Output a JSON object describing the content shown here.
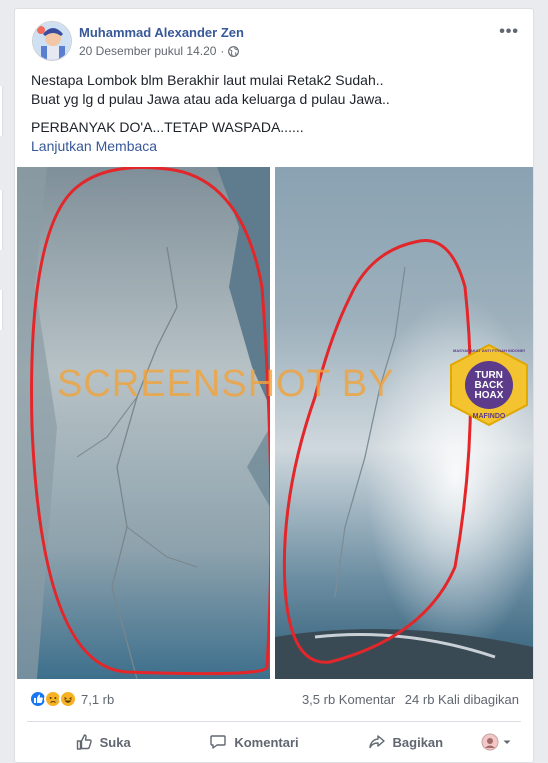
{
  "post": {
    "author": "Muhammad Alexander Zen",
    "timestamp": "20 Desember pukul 14.20",
    "privacy_icon": "globe-icon",
    "more_label": "•••",
    "lines": [
      "Nestapa Lombok blm Berakhir laut mulai Retak2 Sudah..",
      "Buat yg lg d pulau Jawa atau ada keluarga d pulau Jawa.."
    ],
    "line3": "PERBANYAK DO'A...TETAP WASPADA......",
    "see_more": "Lanjutkan Membaca"
  },
  "image": {
    "watermark": "SCREENSHOT BY",
    "logo_line1": "TURN",
    "logo_line2": "BACK",
    "logo_line3": "HOAX",
    "logo_ring_top": "MASYARAKAT ANTI FITNAH INDONESIA",
    "logo_ring_bottom": "MAFINDO"
  },
  "reactions": {
    "count": "7,1 rb",
    "icons": [
      "like-icon",
      "sad-icon",
      "haha-icon"
    ],
    "comments": "3,5 rb Komentar",
    "shares": "24 rb Kali dibagikan"
  },
  "actions": {
    "like": "Suka",
    "comment": "Komentari",
    "share": "Bagikan"
  },
  "colors": {
    "link": "#385898",
    "like_blue": "#1877f2",
    "sad_yellow": "#f7b125",
    "highlight_red": "#e3262a",
    "watermark_orange": "#f2a33a"
  }
}
